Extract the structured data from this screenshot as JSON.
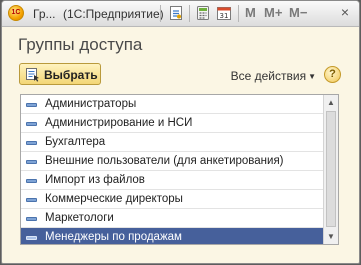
{
  "window": {
    "title_short": "Гр...",
    "title_app": "(1С:Предприятие)",
    "logo_text": "1С",
    "mem_buttons": [
      "M",
      "M+",
      "M−"
    ],
    "close_glyph": "×"
  },
  "form": {
    "title": "Группы доступа",
    "select_label": "Выбрать",
    "all_actions_label": "Все действия",
    "help_glyph": "?"
  },
  "list": {
    "items": [
      "Администраторы",
      "Администрирование и НСИ",
      "Бухгалтера",
      "Внешние пользователи (для анкетирования)",
      "Импорт из файлов",
      "Коммерческие директоры",
      "Маркетологи",
      "Менеджеры по продажам"
    ],
    "selected_index": 7
  },
  "colors": {
    "accent": "#46609b",
    "background": "#fbf6e4",
    "button": "#f3d676"
  }
}
